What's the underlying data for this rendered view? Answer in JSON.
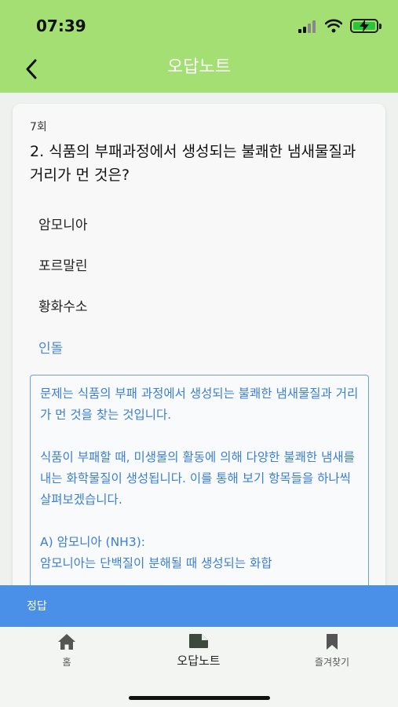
{
  "status": {
    "time": "07:39"
  },
  "header": {
    "title": "오답노트"
  },
  "card": {
    "round": "7회",
    "question": "2. 식품의 부패과정에서 생성되는 불쾌한 냄새물질과 거리가 먼 것은?",
    "options": [
      "암모니아",
      "포르말린",
      "황화수소",
      "인돌"
    ],
    "explanation": "문제는 식품의 부패 과정에서 생성되는 불쾌한 냄새물질과 거리가 먼 것을 찾는 것입니다.\n\n식품이 부패할 때, 미생물의 활동에 의해 다양한 불쾌한 냄새를 내는 화학물질이 생성됩니다. 이를 통해 보기 항목들을 하나씩 살펴보겠습니다.\n\nA) 암모니아 (NH3):\n암모니아는 단백질이 분해될 때 생성되는 화합"
  },
  "answer_bar": {
    "label": "정답"
  },
  "tabs": [
    {
      "label": "홈",
      "icon": "home-icon"
    },
    {
      "label": "오답노트",
      "icon": "note-icon"
    },
    {
      "label": "즐겨찾기",
      "icon": "bookmark-icon"
    }
  ],
  "colors": {
    "header": "#a3df73",
    "accent": "#4a8fe8",
    "correct": "#4a88d6"
  }
}
